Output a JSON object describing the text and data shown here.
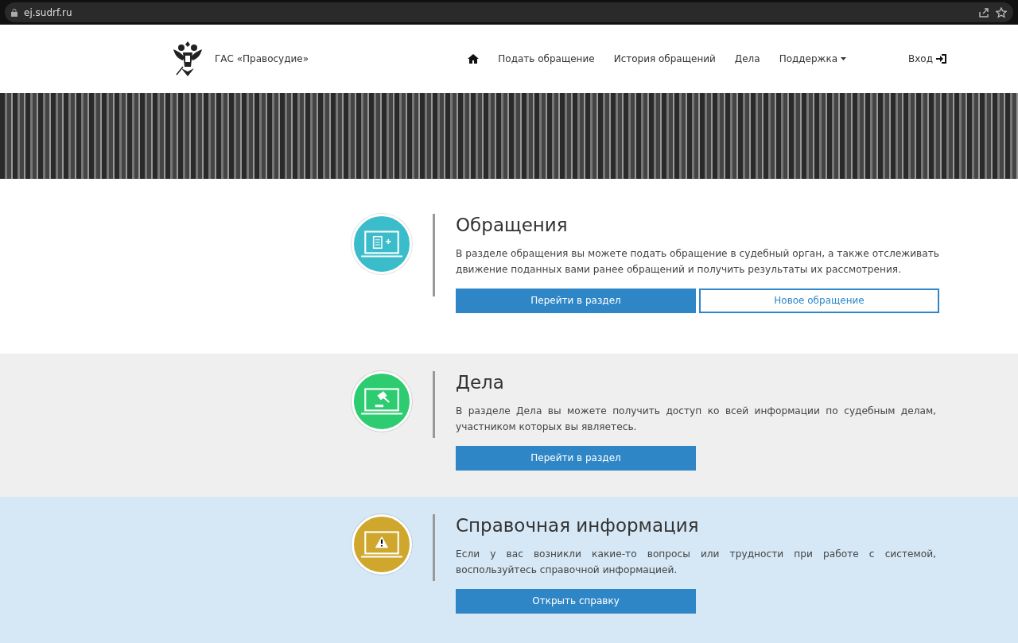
{
  "browser": {
    "url": "ej.sudrf.ru"
  },
  "header": {
    "brand": "ГАС «Правосудие»",
    "nav": [
      {
        "label": "Подать обращение",
        "kind": "link"
      },
      {
        "label": "История обращений",
        "kind": "link"
      },
      {
        "label": "Дела",
        "kind": "link"
      },
      {
        "label": "Поддержка",
        "kind": "dropdown"
      }
    ],
    "login": "Вход"
  },
  "sections": [
    {
      "kind": "appeals",
      "color": "#3bbccb",
      "title": "Обращения",
      "text": "В разделе обращения вы можете подать обращение в судебный орган, а также отслеживать движение поданных вами ранее обращений и получить результаты их рассмотрения.",
      "buttons": [
        {
          "label": "Перейти в раздел",
          "kind": "primary"
        },
        {
          "label": "Новое обращение",
          "kind": "outline"
        }
      ]
    },
    {
      "kind": "cases",
      "color": "#2ecc71",
      "title": "Дела",
      "text": "В разделе Дела вы можете получить доступ ко всей информации по судебным делам, участником которых вы являетесь.",
      "buttons": [
        {
          "label": "Перейти в раздел",
          "kind": "primary"
        }
      ]
    },
    {
      "kind": "info",
      "color": "#cfa72c",
      "title": "Справочная информация",
      "text": "Если у вас возникли какие-то вопросы или трудности при работе с системой, воспользуйтесь справочной информацией.",
      "buttons": [
        {
          "label": "Открыть справку",
          "kind": "primary"
        }
      ]
    }
  ]
}
